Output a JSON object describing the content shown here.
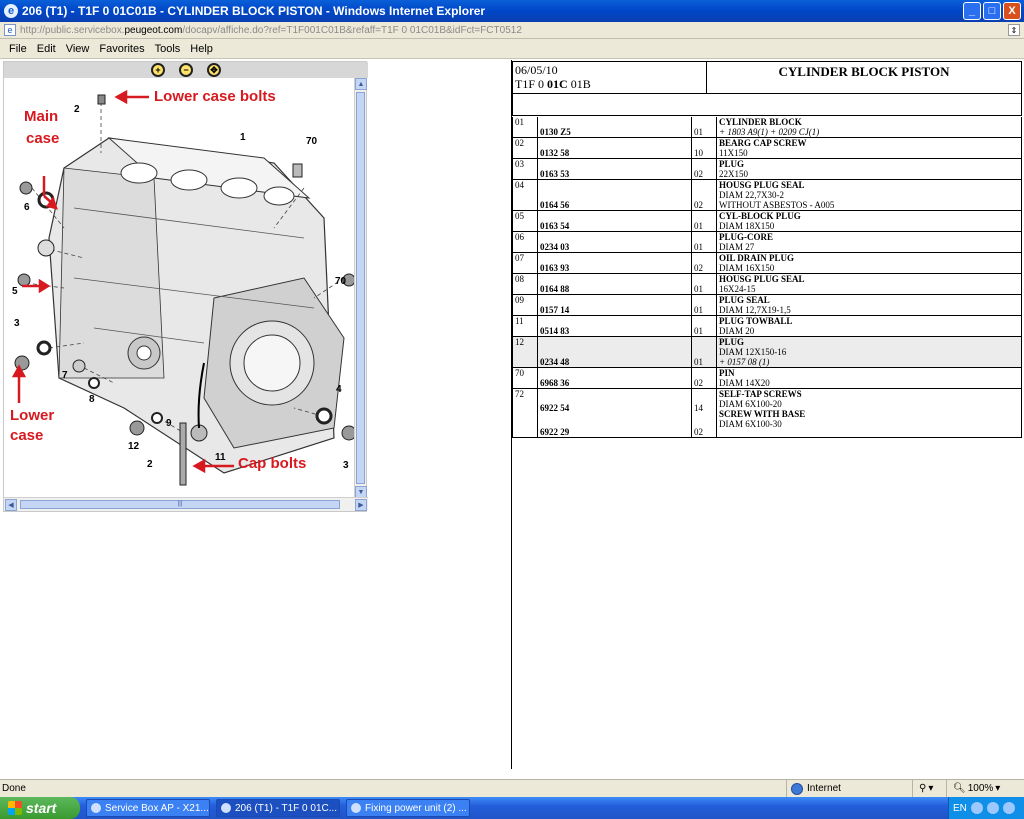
{
  "window": {
    "title": "206 (T1) - T1F 0 01C01B - CYLINDER BLOCK PISTON - Windows Internet Explorer",
    "minimize": "_",
    "maximize": "□",
    "close": "X"
  },
  "address": {
    "url_prefix": "http://public.servicebox.",
    "url_domain": "peugeot.com",
    "url_suffix": "/docapv/affiche.do?ref=T1F001C01B&refaff=T1F  0 01C01B&idFct=FCT0512"
  },
  "menu": [
    "File",
    "Edit",
    "View",
    "Favorites",
    "Tools",
    "Help"
  ],
  "diagram": {
    "callouts": {
      "lower_case_bolts": "Lower case bolts",
      "main_case_1": "Main",
      "main_case_2": "case",
      "lower_case_1": "Lower",
      "lower_case_2": "case",
      "cap_bolts": "Cap bolts"
    },
    "part_numbers": [
      "2",
      "1",
      "70",
      "6",
      "5",
      "70",
      "3",
      "7",
      "8",
      "9",
      "4",
      "12",
      "2",
      "11",
      "3"
    ],
    "hscroll_thumb": "|||"
  },
  "sheet": {
    "date": "06/05/10",
    "ref_prefix": "T1F 0 ",
    "ref_bold": "01C",
    "ref_suffix": " 01B",
    "title": "CYLINDER BLOCK PISTON",
    "rows": [
      {
        "idx": "01",
        "ref": "0130 Z5",
        "qty": "01",
        "desc": "CYLINDER BLOCK",
        "line2": "+ 1803 A9(1) + 0209 CJ(1)",
        "line2_italic": true
      },
      {
        "idx": "02",
        "ref": "0132 58",
        "qty": "10",
        "desc": "BEARG CAP SCREW",
        "line2": "11X150"
      },
      {
        "idx": "03",
        "ref": "0163 53",
        "qty": "02",
        "desc": "PLUG",
        "line2": "22X150"
      },
      {
        "idx": "04",
        "ref": "0164 56",
        "qty": "02",
        "desc": "HOUSG PLUG SEAL",
        "line2": "DIAM 22,7X30-2",
        "line3": "WITHOUT ASBESTOS - A005"
      },
      {
        "idx": "05",
        "ref": "0163 54",
        "qty": "01",
        "desc": "CYL-BLOCK PLUG",
        "line2": "DIAM 18X150"
      },
      {
        "idx": "06",
        "ref": "0234 03",
        "qty": "01",
        "desc": "PLUG-CORE",
        "line2": "DIAM 27"
      },
      {
        "idx": "07",
        "ref": "0163 93",
        "qty": "02",
        "desc": "OIL DRAIN PLUG",
        "line2": "DIAM 16X150"
      },
      {
        "idx": "08",
        "ref": "0164 88",
        "qty": "01",
        "desc": "HOUSG PLUG SEAL",
        "line2": "16X24-15"
      },
      {
        "idx": "09",
        "ref": "0157 14",
        "qty": "01",
        "desc": "PLUG SEAL",
        "line2": "DIAM 12,7X19-1,5"
      },
      {
        "idx": "11",
        "ref": "0514 83",
        "qty": "01",
        "desc": "PLUG TOWBALL",
        "line2": "DIAM 20"
      },
      {
        "idx": "12",
        "ref": "0234 48",
        "qty": "01",
        "desc": "PLUG",
        "line2": "DIAM 12X150-16",
        "line3": "+ 0157 08 (1)",
        "line3_italic": true,
        "shaded": true
      },
      {
        "idx": "70",
        "ref": "6968 36",
        "qty": "02",
        "desc": "PIN",
        "line2": "DIAM 14X20"
      }
    ],
    "last_row": {
      "idx": "72",
      "items": [
        {
          "ref": "6922 54",
          "qty": "14",
          "desc": "SELF-TAP SCREWS",
          "line2": "DIAM 6X100-20"
        },
        {
          "ref": "6922 29",
          "qty": "02",
          "desc": "SCREW WITH BASE",
          "line2": "DIAM 6X100-30"
        }
      ]
    }
  },
  "status": {
    "text": "Done",
    "zone": "Internet",
    "zoom": "100%"
  },
  "taskbar": {
    "start": "start",
    "tasks": [
      "Service Box AP - X21...",
      "206 (T1) - T1F 0 01C...",
      "Fixing power unit (2) ..."
    ],
    "lang": "EN"
  }
}
